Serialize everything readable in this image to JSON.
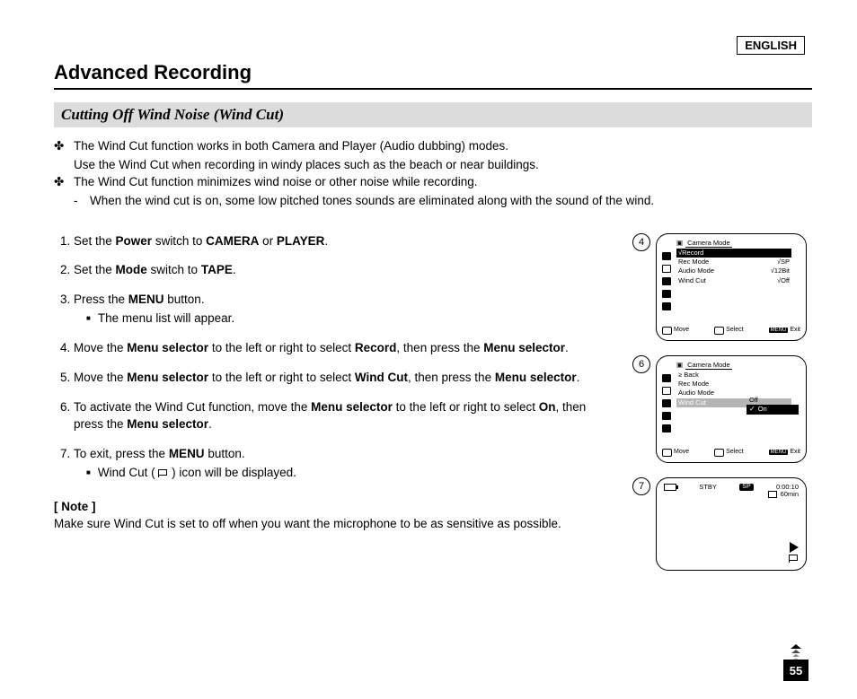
{
  "language_label": "ENGLISH",
  "main_title": "Advanced Recording",
  "section_title": "Cutting Off Wind Noise (Wind Cut)",
  "intro": {
    "p1_line1": "The Wind Cut function works in both Camera and Player (Audio dubbing) modes.",
    "p1_line2": "Use the Wind Cut when recording in windy places such as the beach or near buildings.",
    "p2_line1": "The Wind Cut function minimizes wind noise or other noise while recording.",
    "p2_dash": "When the wind cut is on, some low pitched tones sounds are eliminated along with the sound of the wind."
  },
  "steps": {
    "s1_a": "Set the ",
    "s1_b": "Power",
    "s1_c": " switch to ",
    "s1_d": "CAMERA",
    "s1_e": " or ",
    "s1_f": "PLAYER",
    "s1_g": ".",
    "s2_a": "Set the ",
    "s2_b": "Mode",
    "s2_c": " switch to ",
    "s2_d": "TAPE",
    "s2_e": ".",
    "s3_a": "Press the ",
    "s3_b": "MENU",
    "s3_c": " button.",
    "s3_sub": "The menu list will appear.",
    "s4_a": "Move the ",
    "s4_b": "Menu selector",
    "s4_c": " to the left or right to select ",
    "s4_d": "Record",
    "s4_e": ", then press the ",
    "s4_f": "Menu selector",
    "s4_g": ".",
    "s5_a": "Move the ",
    "s5_b": "Menu selector",
    "s5_c": " to the left or right to select ",
    "s5_d": "Wind Cut",
    "s5_e": ", then press the ",
    "s5_f": "Menu selector",
    "s5_g": ".",
    "s6_a": "To activate the Wind Cut function, move the ",
    "s6_b": "Menu selector",
    "s6_c": " to the left or right to select ",
    "s6_d": "On",
    "s6_e": ", then press the ",
    "s6_f": "Menu selector",
    "s6_g": ".",
    "s7_a": "To exit, press the ",
    "s7_b": "MENU",
    "s7_c": " button.",
    "s7_sub_a": "Wind Cut ( ",
    "s7_sub_b": " ) icon will be displayed."
  },
  "note": {
    "head": "[ Note ]",
    "body": "Make sure Wind Cut is set to off when you want the microphone to be as sensitive as possible."
  },
  "screens": {
    "s4": {
      "num": "4",
      "mode_title": "Camera Mode",
      "record": "√Record",
      "rows": [
        {
          "label": "Rec Mode",
          "value": "√SP"
        },
        {
          "label": "Audio Mode",
          "value": "√12Bit"
        },
        {
          "label": "Wind Cut",
          "value": "√Off"
        }
      ],
      "footer": {
        "move": "Move",
        "select": "Select",
        "menu": "MENU",
        "exit": "Exit"
      }
    },
    "s6": {
      "num": "6",
      "mode_title": "Camera Mode",
      "back": "≥ Back",
      "rows": [
        {
          "label": "Rec Mode"
        },
        {
          "label": "Audio Mode"
        },
        {
          "label": "Wind Cut",
          "hl": true
        }
      ],
      "options": [
        {
          "label": "Off"
        },
        {
          "label": "On",
          "hl": true,
          "check": "✓"
        }
      ],
      "footer": {
        "move": "Move",
        "select": "Select",
        "menu": "MENU",
        "exit": "Exit"
      }
    },
    "s7": {
      "num": "7",
      "stby": "STBY",
      "sp": "SP",
      "time": "0:00:10",
      "remain": "60min"
    }
  },
  "page_number": "55"
}
